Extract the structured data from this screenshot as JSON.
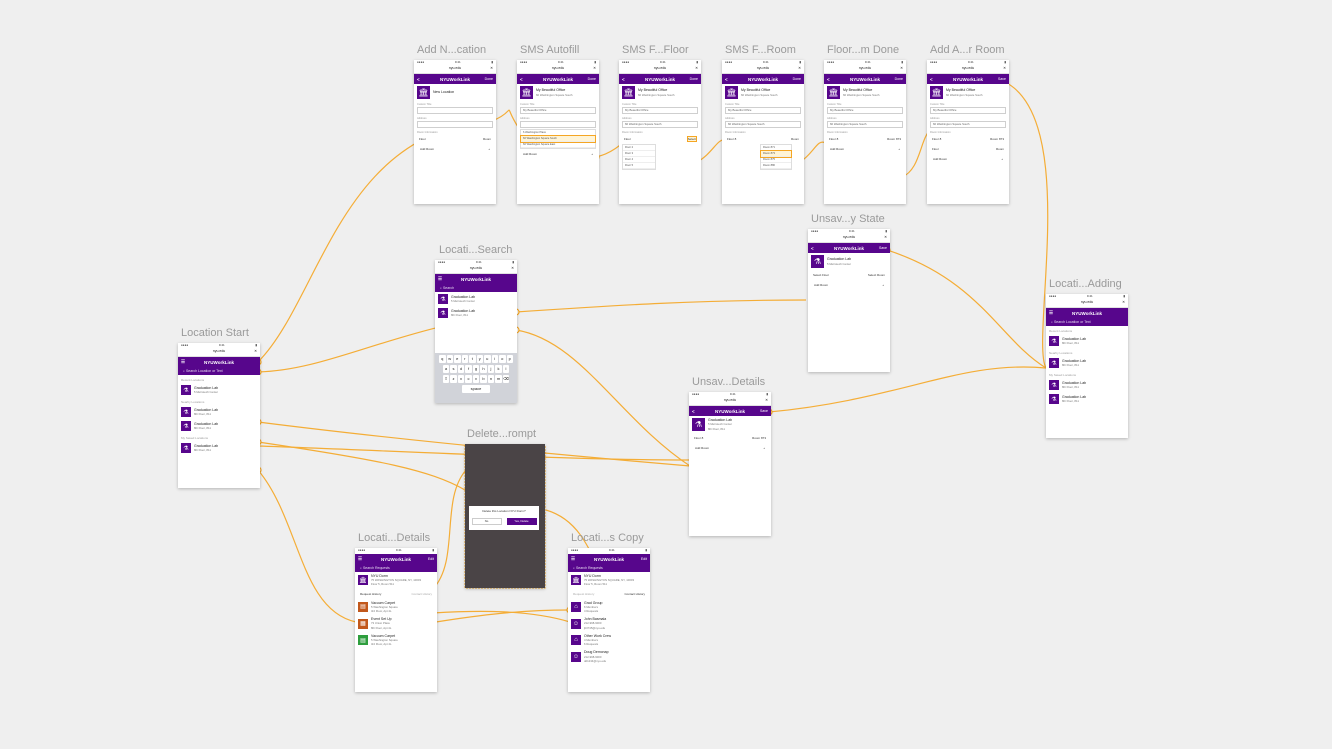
{
  "titles": {
    "s1": "Add N...cation",
    "s2": "SMS Autofill",
    "s3": "SMS F...Floor",
    "s4": "SMS F...Room",
    "s5": "Floor...m Done",
    "s6": "Add A...r Room",
    "unsaved_state": "Unsav...y State",
    "search": "Locati...Search",
    "start": "Location Start",
    "adding": "Locati...Adding",
    "unsaved_details": "Unsav...Details",
    "delete": "Delete...rompt",
    "loc_details": "Locati...Details",
    "loc_copy": "Locati...s Copy"
  },
  "common": {
    "url": "nyu.edu",
    "close": "✕",
    "brand": "NYUWorkLink",
    "back": "<",
    "done": "Done",
    "save": "Save",
    "edit": "Edit",
    "menu": "☰",
    "building_glyph": "🏛",
    "lab_glyph": "⚗",
    "home_glyph": "⌂"
  },
  "form": {
    "new_location": "New Location",
    "office_name": "My Beautiful Office",
    "office_addr": "60 Washington Square South",
    "custom_title_label": "Custom Title",
    "address_label": "Address",
    "room_info_label": "Room Information",
    "floor": "Floor",
    "room": "Room",
    "floor_8": "Floor 8",
    "room_873": "Room 873",
    "add_room": "Add Room",
    "add_room_plus": "+",
    "autofill_options": [
      "6 Washington Place",
      "60 Washington Square South",
      "60 Washington Square East"
    ],
    "floor_options": [
      "Floor 2",
      "Floor 3",
      "Floor 4",
      "Floor 5"
    ],
    "floor_selected": "Select",
    "room_options": [
      "Room 871",
      "Room 873",
      "Room 875",
      "Room 880"
    ]
  },
  "lists": {
    "grad_lab": "Graduation Lab",
    "grad_sub": "5 Metrotech Center",
    "grad_sub2": "8th Floor, 811",
    "search_query": "Search",
    "select_floor": "Select Floor",
    "select_room": "Select Room",
    "search_placeholder": "Search Location or Text",
    "recent": "Recent Locations",
    "nearby": "Nearby Locations",
    "my_locations": "My Saved Locations"
  },
  "delete": {
    "question": "Delete this Location NYU Dorm?",
    "no": "No",
    "yes": "Yes, Delete"
  },
  "details": {
    "search_placeholder": "Search Requests",
    "dorm": "NYU Dorm",
    "dorm_addr": "75 WASHINGTON SQUARE, NY, 10003",
    "dorm_addr2": "Floor 5, Room 511",
    "request_history": "Request History",
    "contact_history": "Contact History",
    "requests": [
      {
        "title": "Vacuum Carpet",
        "sub": "5 Washington Square",
        "sub2": "3rd Floor, Apt 4L",
        "color": "#c2581c"
      },
      {
        "title": "Event Set Up",
        "sub": "73 Union Place",
        "sub2": "8th Floor, Apt 4L",
        "color": "#c2581c"
      },
      {
        "title": "Vacuum Carpet",
        "sub": "5 Washington Square",
        "sub2": "3rd Floor, Apt 4L",
        "color": "#2e9e3e"
      }
    ],
    "contacts": [
      {
        "title": "Grad Group",
        "sub": "6 Members",
        "sub2": "4 Requests"
      },
      {
        "title": "John Basmala",
        "sub": "212-998-9000",
        "sub2": "jb3745@nyu.edu"
      },
      {
        "title": "Other Work Crew",
        "sub": "4 Members",
        "sub2": "6 Requests"
      },
      {
        "title": "Doug Demonap",
        "sub": "212-998-9000",
        "sub2": "dd1234@nyu.edu"
      }
    ]
  },
  "colors": {
    "brand": "#57068c",
    "wire": "#f5a623"
  }
}
